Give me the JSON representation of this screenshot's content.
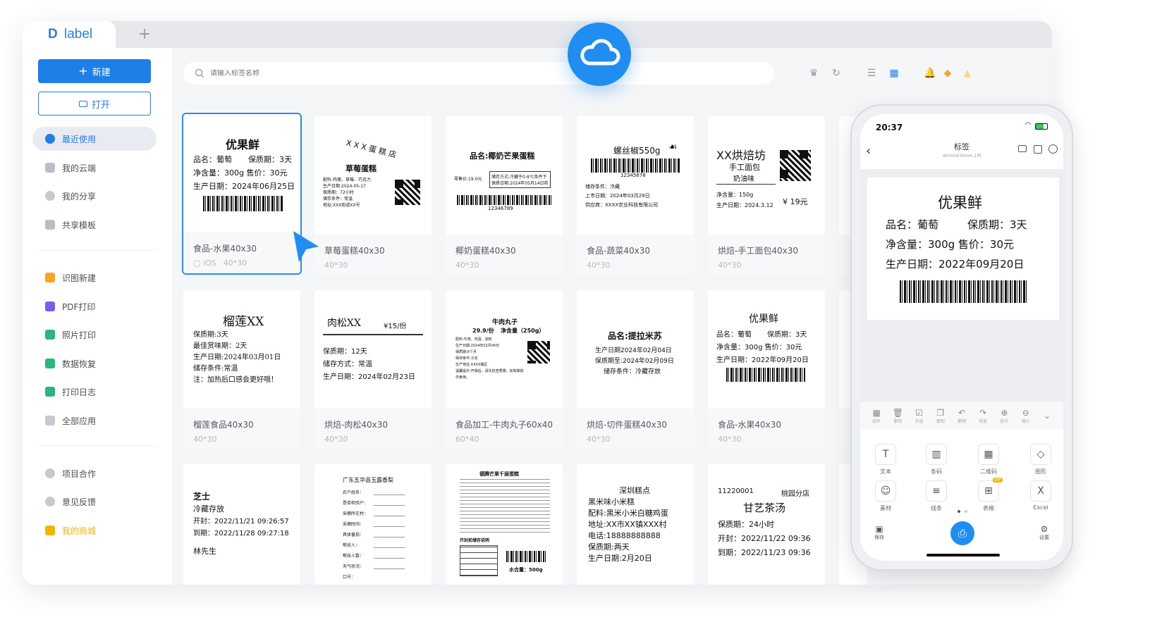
{
  "app": {
    "logo_mark": "D",
    "logo_text": "label",
    "tab_add": "+"
  },
  "sidebar": {
    "new_label": "新建",
    "open_label": "打开",
    "items": [
      {
        "label": "最近使用",
        "icon": "clock-icon",
        "color": "#1e7fe8"
      },
      {
        "label": "我的云端",
        "icon": "cloud-file-icon",
        "color": "#9aa0a8"
      },
      {
        "label": "我的分享",
        "icon": "share-icon",
        "color": "#9aa0a8"
      },
      {
        "label": "共享模板",
        "icon": "template-icon",
        "color": "#9aa0a8"
      },
      {
        "label": "识图新建",
        "icon": "scan-icon",
        "color": "#f5a623"
      },
      {
        "label": "PDF打印",
        "icon": "pdf-icon",
        "color": "#7b5cf0"
      },
      {
        "label": "照片打印",
        "icon": "photo-icon",
        "color": "#2cb67d"
      },
      {
        "label": "数据恢复",
        "icon": "restore-icon",
        "color": "#2cb67d"
      },
      {
        "label": "打印日志",
        "icon": "log-icon",
        "color": "#2cb67d"
      },
      {
        "label": "全部应用",
        "icon": "apps-icon",
        "color": "#9aa0a8"
      },
      {
        "label": "项目合作",
        "icon": "team-icon",
        "color": "#9aa0a8"
      },
      {
        "label": "意见反馈",
        "icon": "feedback-icon",
        "color": "#9aa0a8"
      },
      {
        "label": "我的商城",
        "icon": "shop-icon",
        "color": "#f5b400"
      }
    ]
  },
  "search": {
    "placeholder": "请输入标签名称"
  },
  "cards": [
    {
      "name": "食品-水果40x30",
      "platform": "iOS",
      "size": "40*30"
    },
    {
      "name": "草莓蛋糕40x30",
      "size": "40*30"
    },
    {
      "name": "椰奶蛋糕40x30",
      "size": "40*30"
    },
    {
      "name": "食品-蔬菜40x30",
      "size": "40*30"
    },
    {
      "name": "烘焙-手工面包40x30",
      "size": "40*30"
    },
    {
      "name": "榴莲食品40x30",
      "size": "40*30"
    },
    {
      "name": "烘焙-肉松40x30",
      "size": "40*30"
    },
    {
      "name": "食品加工-牛肉丸子60x40",
      "size": "60*40"
    },
    {
      "name": "烘焙-切件蛋糕40x30",
      "size": "40*30"
    },
    {
      "name": "食品-水果40x30",
      "size": "40*30"
    }
  ],
  "labels": {
    "c1": {
      "title": "优果鲜",
      "l1": "品名：葡萄",
      "l1b": "保质期：3天",
      "l2": "净含量：300g 售价：30元",
      "l3": "生产日期：2024年06月25日"
    },
    "c2": {
      "arc": "X X X 蛋 糕 店",
      "sub": "草莓蛋糕",
      "l1": "配料:鸡蛋、草莓、巧克力",
      "l2": "生产日期:2024-05-17",
      "l3": "保质期：72小时",
      "l4": "储存条件：常温",
      "l5": "地址:XXX街道XX号"
    },
    "c3": {
      "title": "品名:椰奶芒果蛋糕",
      "l1": "零售价:19.0元",
      "l2": "储存方式:冷藏于0-8℃条件下",
      "l3": "保质日期:2024年05月14日前",
      "code": "12346789"
    },
    "c4": {
      "title": "螺丝椒550g",
      "code": "12345678",
      "l1": "储存条件：冷藏",
      "l2": "上市日期：2024年03月29日",
      "l3": "供应商：XXXX农业科技有限公司"
    },
    "c5": {
      "title": "XX烘焙坊",
      "s1": "手工面包",
      "s2": "奶油味",
      "l1": "净含量：150g",
      "l2": "生产日期：2024.3.12",
      "price": "¥ 19元"
    },
    "c6": {
      "title": "榴莲XX",
      "l1": "保质期:3天",
      "l2": "最佳赏味期：2天",
      "l3": "生产日期:2024年03月01日",
      "l4": "储存条件:常温",
      "l5": "注：加热后口感会更好哦！"
    },
    "c7": {
      "title": "肉松XX",
      "price": "¥15/份",
      "l1": "保质期：12天",
      "l2": "储存方式：常温",
      "l3": "生产日期：2024年02月23日"
    },
    "c8": {
      "title": "牛肉丸子",
      "s1": "29.9/份",
      "s2": "净含量（250g）",
      "l1": "配料:牛肉、鸡蛋、淀粉",
      "l2": "生产日期:2024年02月06日",
      "l3": "保质期:6个月",
      "l4": "保存条件:冷冻",
      "l5": "生产地址:XXXX镇区",
      "l6": "温馨提示:开袋后、请先检查质量，如有破损",
      "l7": "勿食用。"
    },
    "c9": {
      "title": "品名:提拉米苏",
      "l1": "生产日期2024年02月04日",
      "l2": "保质期至:2024年02月09日",
      "l3": "储存条件：冷藏存放"
    },
    "c10": {
      "title": "优果鲜",
      "l1": "品名：葡萄",
      "l1b": "保质期：3天",
      "l2": "净含量：300g 售价：30元",
      "l3": "生产日期：2022年09月20日"
    },
    "c11": {
      "title": "芝士",
      "l1": "冷藏存放",
      "l2": "开封：2022/11/21  09:26:57",
      "l3": "到期：2022/11/28  09:27:18",
      "l4": "林先生"
    },
    "c12": {
      "title": "广东五华县玉露香梨",
      "f1": "农户姓名：",
      "f2": "是否检验户：",
      "f3": "采摘所在村：",
      "f4": "采摘时间：",
      "f5": "具体番茄：",
      "f6": "帮扶人：",
      "f7": "帮扶人数：",
      "f8": "天气状况：",
      "f9": "口号："
    },
    "c13": {
      "title": "德腾芒果千层蛋糕",
      "l1": "开封前储存说明",
      "price": "水合量：500g"
    },
    "c14": {
      "title": "深圳糕点",
      "l1": "黑米味小米糕",
      "l2": "配料:黑米小米白糖鸡蛋",
      "l3": "地址:XX市XX镇XXX村",
      "l4": "电话:18888888888",
      "l5": "保质期:两天",
      "l6": "生产日期:2月20日"
    },
    "c15": {
      "code": "11220001",
      "shop": "桃园分店",
      "title": "甘艺茶汤",
      "l1": "保质期：24小时",
      "l2": "开封：2022/11/22  09:36",
      "l3": "到期：2022/11/23  09:36"
    }
  },
  "phone": {
    "time": "20:37",
    "title": "标签",
    "subtitle": "40mmX30mm,1列",
    "label": {
      "title": "优果鲜",
      "l1": "品名：葡萄",
      "l1b": "保质期：3天",
      "l2": "净含量：300g 售价：30元",
      "l3": "生产日期：2022年09月20日"
    },
    "toolbar": [
      "组件",
      "删除",
      "多选",
      "复制",
      "撤销",
      "恢复",
      "放大",
      "缩小"
    ],
    "grid": [
      "文本",
      "条码",
      "二维码",
      "图形",
      "素材",
      "线条",
      "表格",
      "Excel"
    ],
    "vip": "VIP",
    "save": "保存",
    "settings": "设置"
  },
  "colors": {
    "accent": "#1e7fe8",
    "cloud": "#1f8ef0"
  }
}
